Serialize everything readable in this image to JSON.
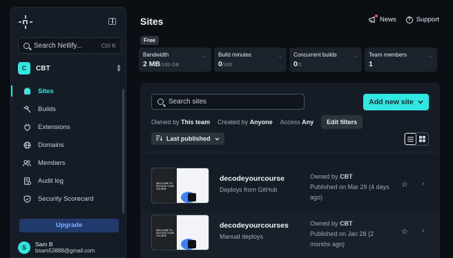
{
  "sidebar": {
    "search_placeholder": "Search Netlify...",
    "search_shortcut": "Ctrl K",
    "team": {
      "badge": "C",
      "name": "CBT"
    },
    "items": [
      {
        "label": "Sites",
        "icon": "layers-icon",
        "active": true
      },
      {
        "label": "Builds",
        "icon": "hammer-icon"
      },
      {
        "label": "Extensions",
        "icon": "plug-icon"
      },
      {
        "label": "Domains",
        "icon": "globe-icon"
      },
      {
        "label": "Members",
        "icon": "users-icon"
      },
      {
        "label": "Audit log",
        "icon": "log-icon"
      },
      {
        "label": "Security Scorecard",
        "icon": "shield-icon"
      }
    ],
    "upgrade_label": "Upgrade",
    "user": {
      "initial": "S",
      "name": "Sam B",
      "email": "bsam53888@gmail.com"
    }
  },
  "header": {
    "title": "Sites",
    "news_label": "News",
    "support_label": "Support",
    "plan_badge": "Free"
  },
  "stats": [
    {
      "label": "Bandwidth",
      "value": "2 MB",
      "limit": "/100 GB"
    },
    {
      "label": "Build minutes",
      "value": "0",
      "limit": "/300"
    },
    {
      "label": "Concurrent builds",
      "value": "0",
      "limit": "/1"
    },
    {
      "label": "Team members",
      "value": "1",
      "limit": ""
    }
  ],
  "sites_panel": {
    "search_placeholder": "Search sites",
    "add_label": "Add new site",
    "filter_owned_label": "Owned by",
    "filter_owned_value": "This team",
    "filter_created_label": "Created by",
    "filter_created_value": "Anyone",
    "filter_access_label": "Access",
    "filter_access_value": "Any",
    "edit_filters_label": "Edit filters",
    "sort_label": "Last published",
    "sites": [
      {
        "name": "decodeyourcourse",
        "sub": "Deploys from GitHub",
        "owner_prefix": "Owned by",
        "owner": "CBT",
        "published": "Published on Mar 29 (4 days ago)",
        "thumb_text": "WELCOME TO DECODE YOUR COURSE"
      },
      {
        "name": "decodeyourcourses",
        "sub": "Manual deploys",
        "owner_prefix": "Owned by",
        "owner": "CBT",
        "published": "Published on Jan 28 (2 months ago)",
        "thumb_text": "WELCOME TO DECODE YOUR COURSE"
      }
    ]
  },
  "colors": {
    "accent": "#32e6e2",
    "background": "#0b0f14",
    "panel": "#161c25"
  }
}
